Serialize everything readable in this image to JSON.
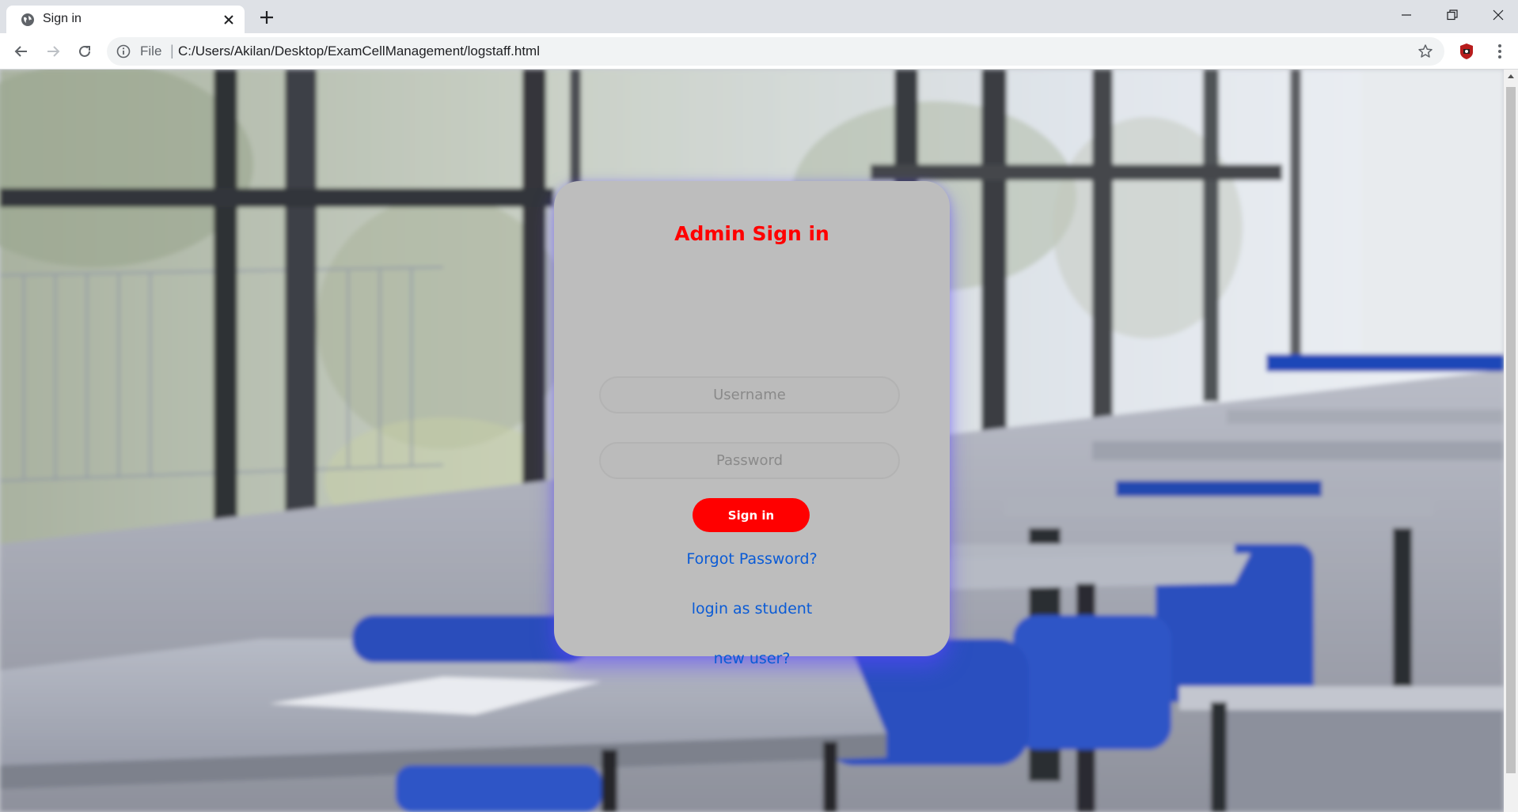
{
  "browser": {
    "tab_title": "Sign in",
    "scheme_label": "File",
    "address_separator": "|",
    "url": "C:/Users/Akilan/Desktop/ExamCellManagement/logstaff.html",
    "icons": {
      "favicon": "globe-icon",
      "close": "close-icon",
      "new_tab": "plus-icon",
      "back": "back-arrow-icon",
      "forward": "forward-arrow-icon",
      "reload": "reload-icon",
      "info": "info-icon",
      "star": "star-icon",
      "extension": "extension-icon",
      "menu": "kebab-menu-icon",
      "minimize": "minimize-icon",
      "restore": "restore-icon",
      "window_close": "window-close-icon"
    }
  },
  "page": {
    "background": "classroom-photo",
    "card": {
      "title": "Admin Sign in",
      "username_placeholder": "Username",
      "password_placeholder": "Password",
      "signin_label": "Sign in",
      "forgot_link": "Forgot Password?",
      "student_link": "login as student",
      "new_user_link": "new user?"
    }
  },
  "colors": {
    "title": "#ff0000",
    "button": "#ff0000",
    "link": "#0a5bd6",
    "card": "#bdbdbd",
    "glow": "#5a46ff"
  }
}
